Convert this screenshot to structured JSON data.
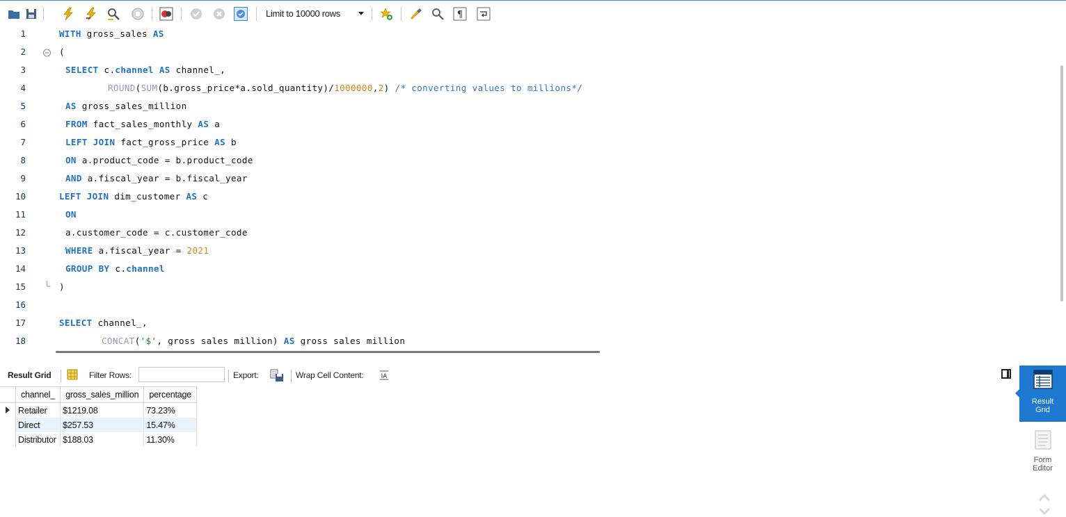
{
  "toolbar": {
    "limit_label": "Limit to 10000 rows",
    "icons": [
      "folder-open-icon",
      "save-icon",
      "execute-icon",
      "execute-current-icon",
      "explain-icon",
      "stop-icon",
      "toggle-error-icon",
      "commit-icon",
      "rollback-icon",
      "autocommit-icon",
      "limit-dropdown",
      "add-snippet-icon",
      "beautify-icon",
      "find-icon",
      "invisible-chars-icon",
      "wrap-icon"
    ]
  },
  "editor": {
    "line_numbers": [
      "1",
      "2",
      "3",
      "4",
      "5",
      "6",
      "7",
      "8",
      "9",
      "10",
      "11",
      "12",
      "13",
      "14",
      "15",
      "16",
      "17",
      "18"
    ]
  },
  "results": {
    "result_grid_label": "Result Grid",
    "filter_label": "Filter Rows:",
    "filter_value": "",
    "export_label": "Export:",
    "wrap_label": "Wrap Cell Content:",
    "columns": [
      "channel_",
      "gross_sales_million",
      "percentage"
    ],
    "rows": [
      [
        "Retailer",
        "$1219.08",
        "73.23%"
      ],
      [
        "Direct",
        "$257.53",
        "15.47%"
      ],
      [
        "Distributor",
        "$188.03",
        "11.30%"
      ]
    ]
  },
  "side_panel": {
    "result_grid_label_1": "Result",
    "result_grid_label_2": "Grid",
    "form_editor_label_1": "Form",
    "form_editor_label_2": "Editor"
  },
  "colors": {
    "accent": "#1e7ad0",
    "keyword": "#1e72c9",
    "number": "#e0841a",
    "comment": "#2f7ac6",
    "function": "#8d9ab8"
  }
}
